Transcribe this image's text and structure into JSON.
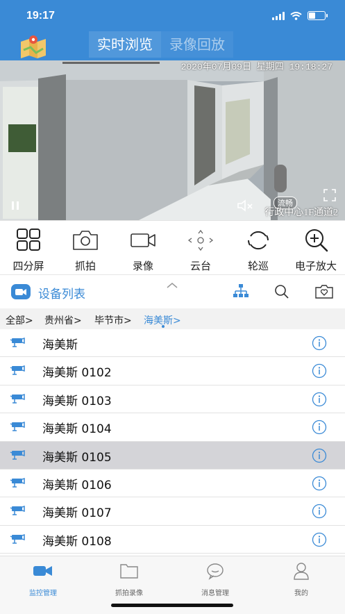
{
  "status_bar": {
    "time": "19:17"
  },
  "header": {
    "tabs": [
      {
        "label": "实时浏览"
      },
      {
        "label": "录像回放"
      }
    ]
  },
  "video": {
    "osd_datetime": "2020年07月09日  星期四  19:18:27",
    "osd_channel": "行政中心1F通道2",
    "flow_badge": "流畅"
  },
  "toolbar": {
    "items": [
      {
        "label": "四分屏",
        "icon": "grid-four-icon"
      },
      {
        "label": "抓拍",
        "icon": "camera-icon"
      },
      {
        "label": "录像",
        "icon": "video-icon"
      },
      {
        "label": "云台",
        "icon": "ptz-icon"
      },
      {
        "label": "轮巡",
        "icon": "cycle-icon"
      },
      {
        "label": "电子放大",
        "icon": "zoom-in-icon"
      }
    ]
  },
  "device_panel": {
    "title": "设备列表"
  },
  "breadcrumb": {
    "items": [
      "全部>",
      "贵州省>",
      "毕节市>",
      "海美斯>"
    ]
  },
  "devices": [
    {
      "name": "海美斯"
    },
    {
      "name": "海美斯 0102"
    },
    {
      "name": "海美斯 0103"
    },
    {
      "name": "海美斯 0104"
    },
    {
      "name": "海美斯 0105"
    },
    {
      "name": "海美斯 0106"
    },
    {
      "name": "海美斯 0107"
    },
    {
      "name": "海美斯 0108"
    }
  ],
  "tabbar": {
    "items": [
      {
        "label": "监控管理",
        "icon": "monitor-camera-icon"
      },
      {
        "label": "抓拍录像",
        "icon": "folder-icon"
      },
      {
        "label": "消息管理",
        "icon": "message-icon"
      },
      {
        "label": "我的",
        "icon": "user-icon"
      }
    ]
  },
  "colors": {
    "brand": "#3a8ad6",
    "selected_row": "#d4d4d8"
  }
}
